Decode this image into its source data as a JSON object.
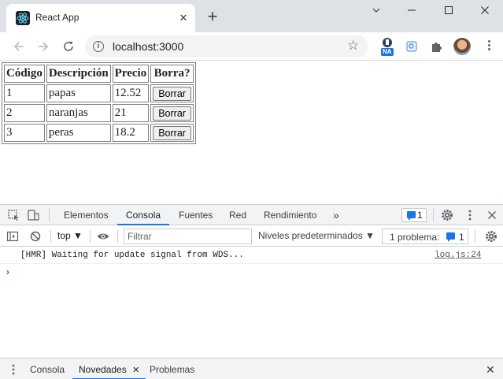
{
  "browser": {
    "tab_title": "React App",
    "tab_close_glyph": "✕",
    "new_tab_glyph": "+",
    "url": "localhost:3000",
    "info_glyph": "i",
    "star_glyph": "☆",
    "extension_badge": "NA"
  },
  "page": {
    "headers": [
      "Código",
      "Descripción",
      "Precio",
      "Borra?"
    ],
    "rows": [
      {
        "codigo": "1",
        "descripcion": "papas",
        "precio": "12.52",
        "action": "Borrar"
      },
      {
        "codigo": "2",
        "descripcion": "naranjas",
        "precio": "21",
        "action": "Borrar"
      },
      {
        "codigo": "3",
        "descripcion": "peras",
        "precio": "18.2",
        "action": "Borrar"
      }
    ]
  },
  "devtools": {
    "tabs": {
      "elementos": "Elementos",
      "consola": "Consola",
      "fuentes": "Fuentes",
      "red": "Red",
      "rendimiento": "Rendimiento",
      "more": "»"
    },
    "issues_count": "1",
    "context": "top ▼",
    "filter_placeholder": "Filtrar",
    "levels": "Niveles predeterminados ▼",
    "problems_label": "1 problema:",
    "problems_count": "1",
    "console": {
      "message": "[HMR] Waiting for update signal from WDS...",
      "source": "log.js:24",
      "prompt": "›"
    },
    "drawer": {
      "consola": "Consola",
      "novedades": "Novedades",
      "novedades_close": "✕",
      "problemas": "Problemas",
      "close": "✕"
    }
  },
  "colors": {
    "accent": "#1a73e8",
    "tabstrip": "#dee1e6",
    "devtools_bar": "#f1f3f4"
  }
}
